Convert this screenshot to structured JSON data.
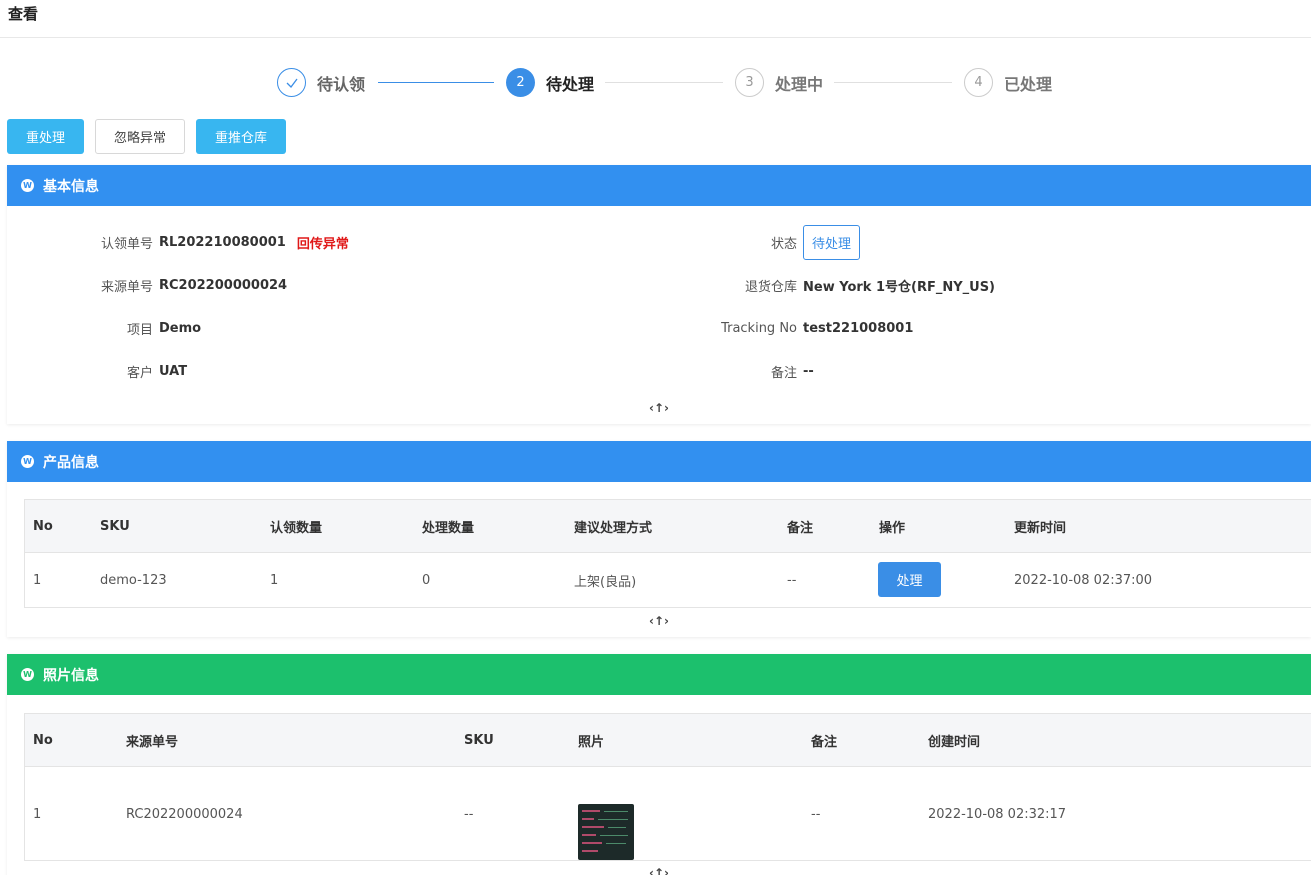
{
  "page": {
    "title": "查看"
  },
  "steps": [
    {
      "num": "✓",
      "label": "待认领",
      "state": "done"
    },
    {
      "num": "2",
      "label": "待处理",
      "state": "active"
    },
    {
      "num": "3",
      "label": "处理中",
      "state": "wait"
    },
    {
      "num": "4",
      "label": "已处理",
      "state": "wait"
    }
  ],
  "actions": {
    "reprocess": "重处理",
    "ignore": "忽略异常",
    "repush": "重推仓库"
  },
  "basic": {
    "title": "基本信息",
    "claim_no_label": "认领单号",
    "claim_no": "RL202210080001",
    "claim_error": "回传异常",
    "status_label": "状态",
    "status": "待处理",
    "source_no_label": "来源单号",
    "source_no": "RC202200000024",
    "warehouse_label": "退货仓库",
    "warehouse": "New York 1号仓(RF_NY_US)",
    "project_label": "项目",
    "project": "Demo",
    "tracking_label": "Tracking No",
    "tracking": "test221008001",
    "customer_label": "客户",
    "customer": "UAT",
    "remark_label": "备注",
    "remark": "--"
  },
  "product": {
    "title": "产品信息",
    "columns": [
      "No",
      "SKU",
      "认领数量",
      "处理数量",
      "建议处理方式",
      "备注",
      "操作",
      "更新时间"
    ],
    "rows": [
      {
        "no": "1",
        "sku": "demo-123",
        "claim_qty": "1",
        "proc_qty": "0",
        "method": "上架(良品)",
        "remark": "--",
        "action": "处理",
        "updated": "2022-10-08 02:37:00"
      }
    ]
  },
  "photo": {
    "title": "照片信息",
    "columns": [
      "No",
      "来源单号",
      "SKU",
      "照片",
      "备注",
      "创建时间"
    ],
    "rows": [
      {
        "no": "1",
        "source_no": "RC202200000024",
        "sku": "--",
        "remark": "--",
        "created": "2022-10-08 02:32:17"
      }
    ]
  },
  "collapse_icon": "‹↑›"
}
